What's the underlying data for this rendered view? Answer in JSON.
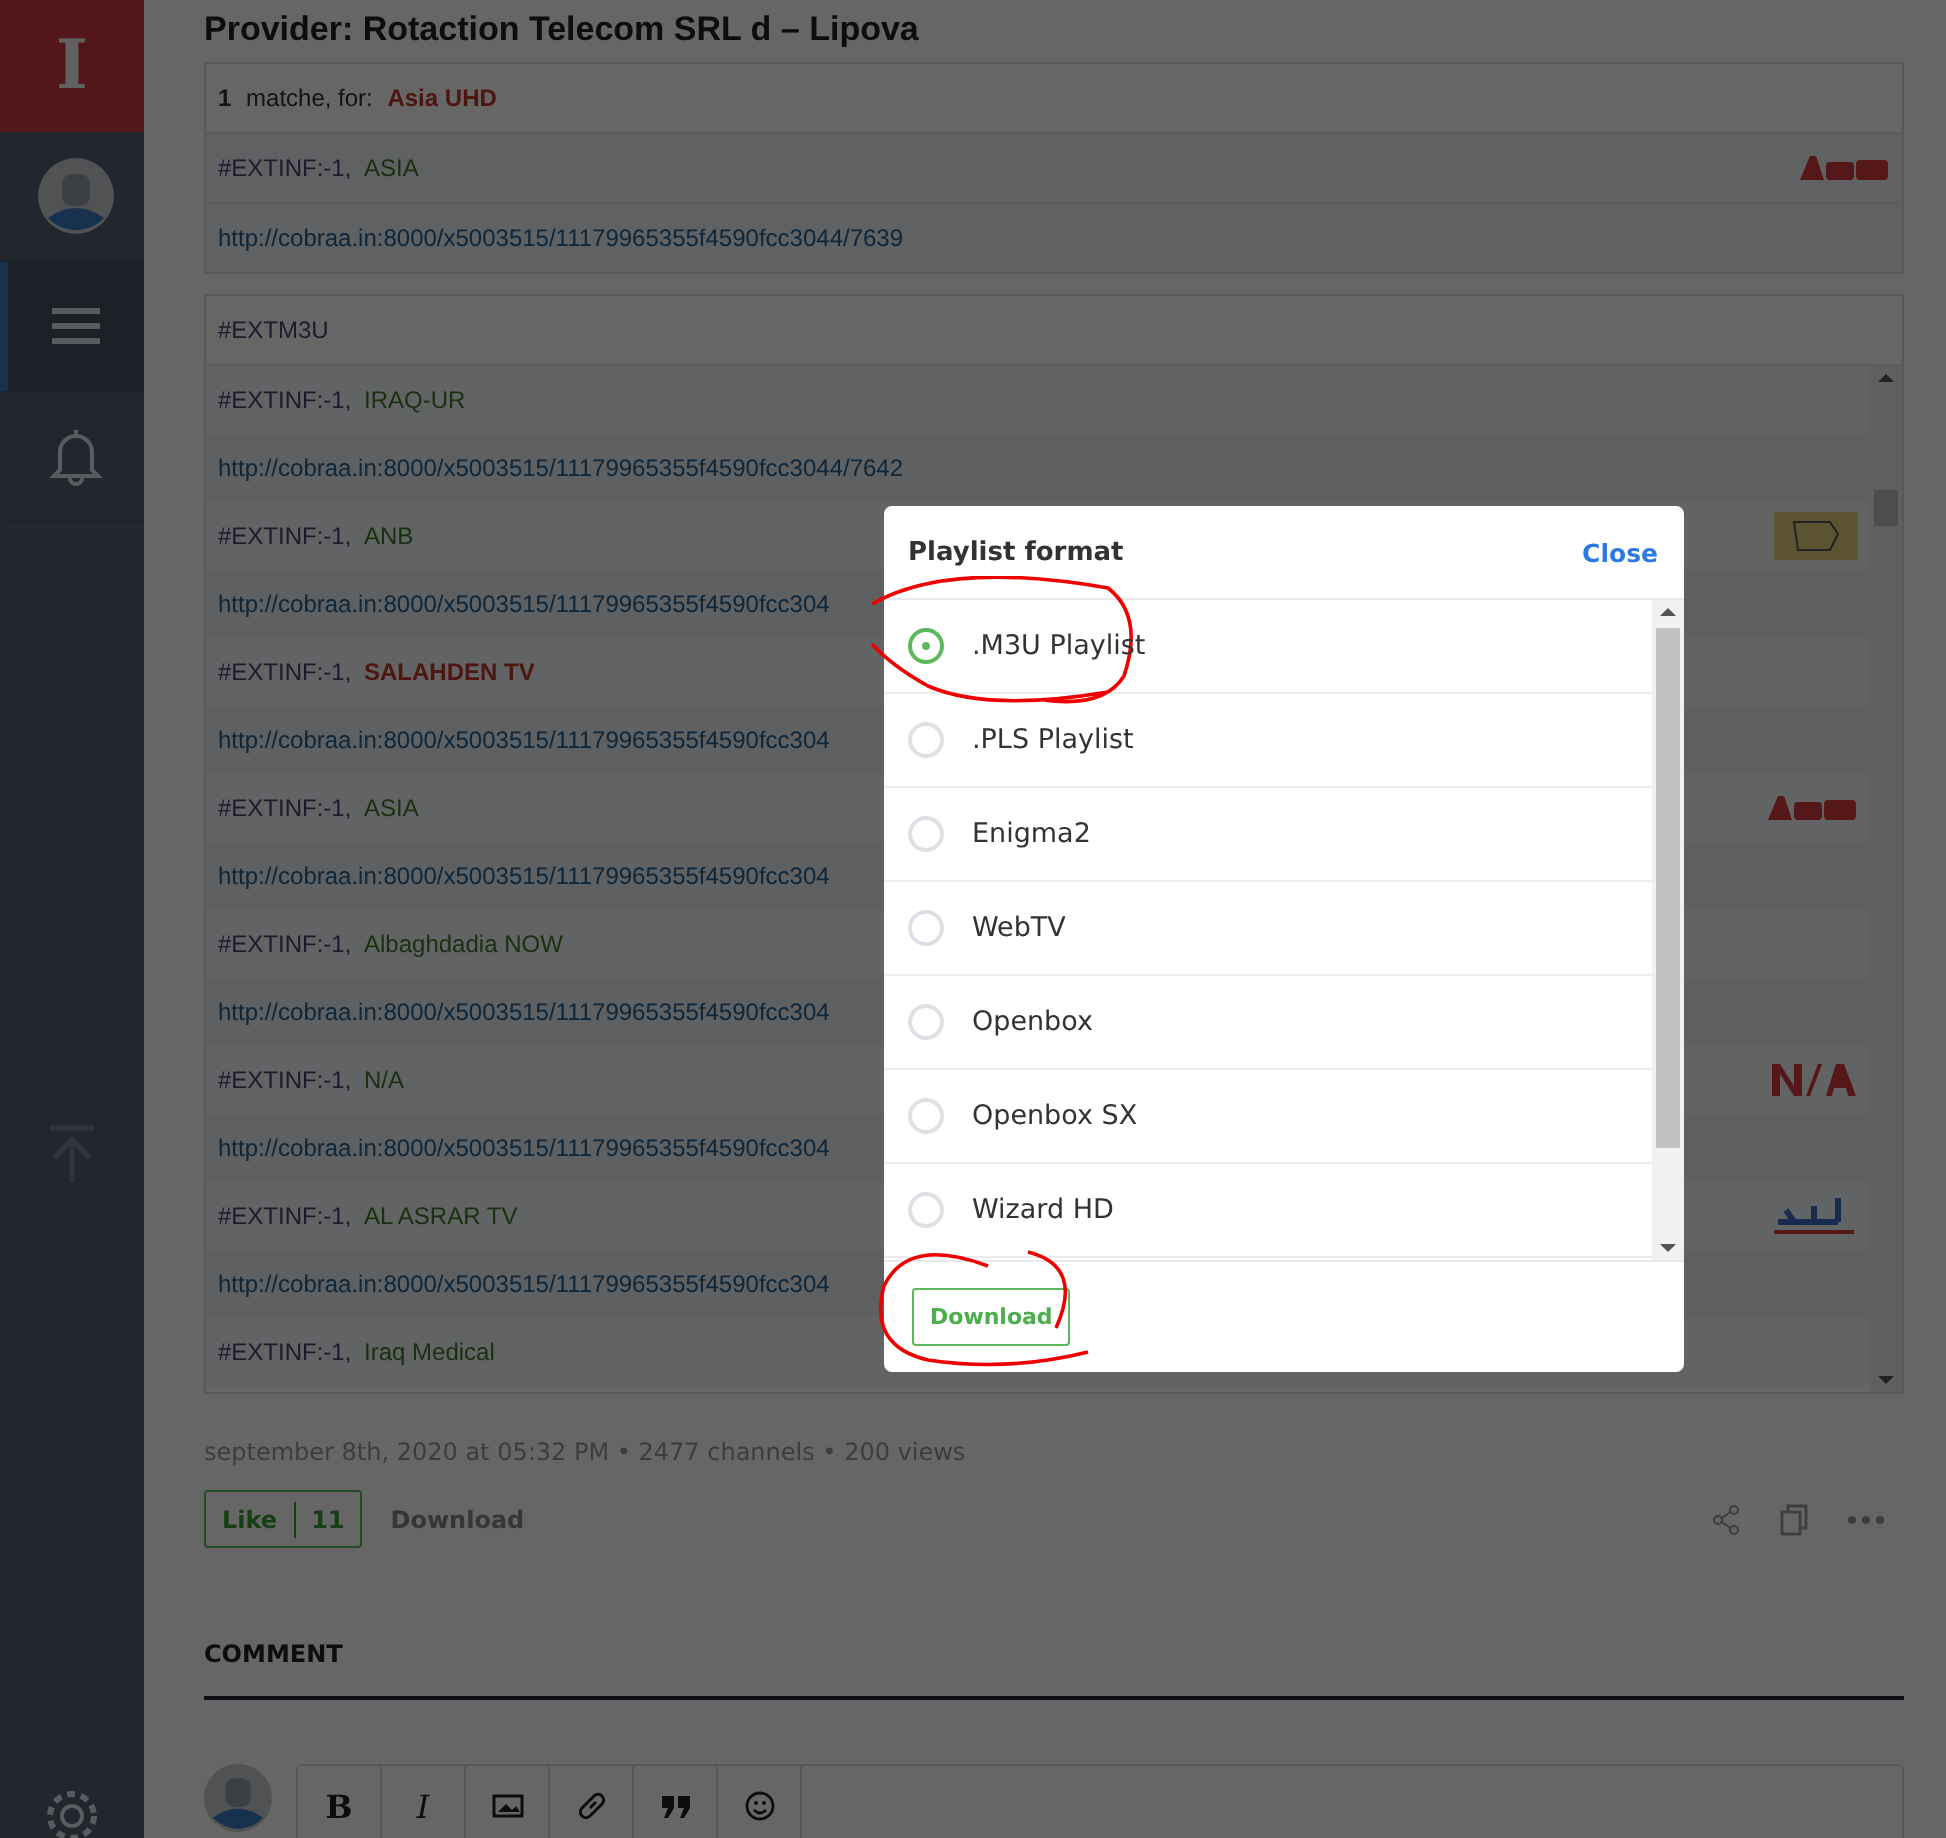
{
  "sidebar": {
    "logo_letter": "I",
    "items": [
      {
        "kind": "avatar",
        "selected": false
      },
      {
        "kind": "menu",
        "selected": true
      },
      {
        "kind": "bell",
        "selected": false
      }
    ]
  },
  "title": "Provider: Rotaction Telecom SRL d – Lipova",
  "match": {
    "count": "1",
    "text": "matche, for:",
    "query": "Asia UHD",
    "entry": {
      "prefix": "#EXTINF:-1,",
      "name": "ASIA",
      "highlight": false,
      "kind": "asia",
      "url": "http://cobraa.in:8000/x5003515/11179965355f4590fcc3044/7639"
    }
  },
  "playlist": {
    "header": "#EXTM3U",
    "entries": [
      {
        "prefix": "#EXTINF:-1,",
        "name": "IRAQ-UR",
        "highlight": false,
        "kind": "plain",
        "url": "http://cobraa.in:8000/x5003515/11179965355f4590fcc3044/7642"
      },
      {
        "prefix": "#EXTINF:-1,",
        "name": "ANB",
        "highlight": false,
        "kind": "anb",
        "url": "http://cobraa.in:8000/x5003515/11179965355f4590fcc304"
      },
      {
        "prefix": "#EXTINF:-1,",
        "name": "SALAHDEN TV",
        "highlight": true,
        "kind": "plain",
        "url": "http://cobraa.in:8000/x5003515/11179965355f4590fcc304"
      },
      {
        "prefix": "#EXTINF:-1,",
        "name": "ASIA",
        "highlight": false,
        "kind": "asia",
        "url": "http://cobraa.in:8000/x5003515/11179965355f4590fcc304"
      },
      {
        "prefix": "#EXTINF:-1,",
        "name": "Albaghdadia NOW",
        "highlight": false,
        "kind": "plain",
        "url": "http://cobraa.in:8000/x5003515/11179965355f4590fcc304"
      },
      {
        "prefix": "#EXTINF:-1,",
        "name": "N/A",
        "highlight": false,
        "kind": "na",
        "url": "http://cobraa.in:8000/x5003515/11179965355f4590fcc304"
      },
      {
        "prefix": "#EXTINF:-1,",
        "name": "AL ASRAR TV",
        "highlight": false,
        "kind": "asrar",
        "url": "http://cobraa.in:8000/x5003515/11179965355f4590fcc304"
      },
      {
        "prefix": "#EXTINF:-1,",
        "name": "Iraq Medical",
        "highlight": false,
        "kind": "plain"
      }
    ]
  },
  "meta": "september 8th, 2020 at 05:32 PM • 2477 channels • 200 views",
  "like": {
    "label": "Like",
    "count": "11"
  },
  "download_link": "Download",
  "comment_heading": "COMMENT",
  "editor_tools": [
    {
      "kind": "bold",
      "label": "B"
    },
    {
      "kind": "italic",
      "label": "I"
    },
    {
      "kind": "image"
    },
    {
      "kind": "link"
    },
    {
      "kind": "quote"
    },
    {
      "kind": "emoji"
    }
  ],
  "dialog": {
    "title": "Playlist format",
    "close": "Close",
    "options": [
      {
        "label": ".M3U Playlist",
        "selected": true
      },
      {
        "label": ".PLS Playlist",
        "selected": false
      },
      {
        "label": "Enigma2",
        "selected": false
      },
      {
        "label": "WebTV",
        "selected": false
      },
      {
        "label": "Openbox",
        "selected": false
      },
      {
        "label": "Openbox SX",
        "selected": false
      },
      {
        "label": "Wizard HD",
        "selected": false
      }
    ],
    "button": "Download"
  }
}
